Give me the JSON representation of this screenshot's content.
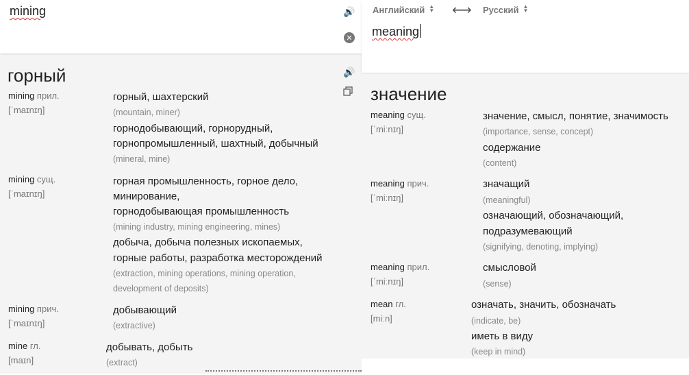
{
  "source": {
    "text": "mining"
  },
  "target": {
    "text": "meaning",
    "from_lang": "Английский",
    "to_lang": "Русский"
  },
  "icons": {
    "speaker": "🔊",
    "clear": "✕",
    "swap": "⟷",
    "sort": "▲▼"
  },
  "left_dict": {
    "headword": "горный",
    "entries": [
      {
        "word": "mining",
        "pos": "прил.",
        "phon": "[ˈmaɪnɪŋ]",
        "senses": [
          {
            "tr": "горный, шахтерский",
            "bt": "(mountain, miner)"
          },
          {
            "tr": "горнодобывающий, горнорудный,",
            "tr2": "горнопромышленный, шахтный, добычный",
            "bt": "(mineral, mine)"
          }
        ]
      },
      {
        "word": "mining",
        "pos": "сущ.",
        "phon": "[ˈmaɪnɪŋ]",
        "senses": [
          {
            "tr": "горная промышленность, горное дело,",
            "tr2": "минирование,",
            "tr3": "горнодобывающая промышленность",
            "bt": "(mining industry, mining engineering, mines)"
          },
          {
            "tr": "добыча, добыча полезных ископаемых,",
            "tr2": "горные работы, разработка месторождений",
            "bt": "(extraction, mining operations, mining operation,",
            "bt2": "development of deposits)"
          }
        ]
      },
      {
        "word": "mining",
        "pos": "прич.",
        "phon": "[ˈmaɪnɪŋ]",
        "senses": [
          {
            "tr": "добывающий",
            "bt": "(extractive)"
          }
        ]
      },
      {
        "word": "mine",
        "pos": "гл.",
        "phon": "[maɪn]",
        "senses": [
          {
            "tr": "добывать, добыть",
            "bt": "(extract)"
          }
        ]
      }
    ]
  },
  "right_dict": {
    "headword": "значение",
    "entries": [
      {
        "word": "meaning",
        "pos": "сущ.",
        "phon": "[ˈmiːnɪŋ]",
        "senses": [
          {
            "tr": "значение, смысл, понятие, значимость",
            "bt": "(importance, sense, concept)"
          },
          {
            "tr": "содержание",
            "bt": "(content)"
          }
        ]
      },
      {
        "word": "meaning",
        "pos": "прич.",
        "phon": "[ˈmiːnɪŋ]",
        "senses": [
          {
            "tr": "значащий",
            "bt": "(meaningful)"
          },
          {
            "tr": "означающий, обозначающий,",
            "tr2": "подразумевающий",
            "bt": "(signifying, denoting, implying)"
          }
        ]
      },
      {
        "word": "meaning",
        "pos": "прил.",
        "phon": "[ˈmiːnɪŋ]",
        "senses": [
          {
            "tr": "смысловой",
            "bt": "(sense)"
          }
        ]
      },
      {
        "word": "mean",
        "pos": "гл.",
        "phon": "[miːn]",
        "senses": [
          {
            "tr": "означать, значить, обозначать",
            "bt": "(indicate, be)"
          },
          {
            "tr": "иметь в виду",
            "bt": "(keep in mind)"
          }
        ]
      }
    ]
  }
}
